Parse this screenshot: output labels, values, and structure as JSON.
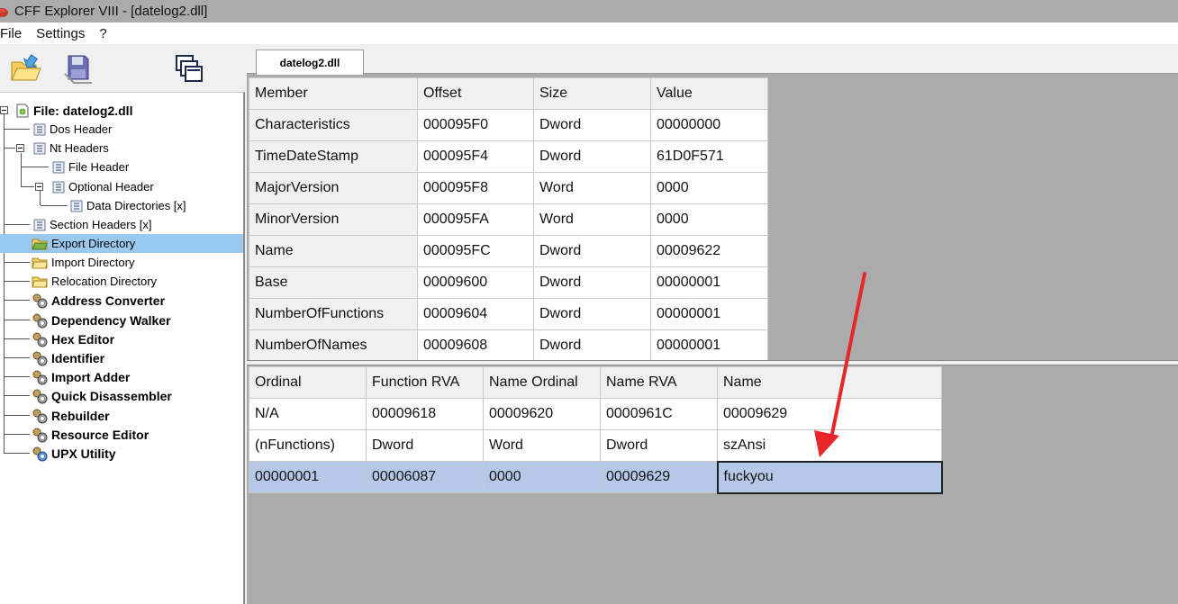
{
  "window": {
    "title": "CFF Explorer VIII - [datelog2.dll]"
  },
  "menu": [
    "File",
    "Settings",
    "?"
  ],
  "tree": {
    "root": "File: datelog2.dll",
    "items": [
      {
        "label": "Dos Header"
      },
      {
        "label": "Nt Headers"
      },
      {
        "label": "File Header"
      },
      {
        "label": "Optional Header"
      },
      {
        "label": "Data Directories [x]"
      },
      {
        "label": "Section Headers [x]"
      },
      {
        "label": "Export Directory"
      },
      {
        "label": "Import Directory"
      },
      {
        "label": "Relocation Directory"
      },
      {
        "label": "Address Converter"
      },
      {
        "label": "Dependency Walker"
      },
      {
        "label": "Hex Editor"
      },
      {
        "label": "Identifier"
      },
      {
        "label": "Import Adder"
      },
      {
        "label": "Quick Disassembler"
      },
      {
        "label": "Rebuilder"
      },
      {
        "label": "Resource Editor"
      },
      {
        "label": "UPX Utility"
      }
    ]
  },
  "tab": {
    "label": "datelog2.dll"
  },
  "export_table": {
    "headers": [
      "Member",
      "Offset",
      "Size",
      "Value"
    ],
    "rows": [
      [
        "Characteristics",
        "000095F0",
        "Dword",
        "00000000"
      ],
      [
        "TimeDateStamp",
        "000095F4",
        "Dword",
        "61D0F571"
      ],
      [
        "MajorVersion",
        "000095F8",
        "Word",
        "0000"
      ],
      [
        "MinorVersion",
        "000095FA",
        "Word",
        "0000"
      ],
      [
        "Name",
        "000095FC",
        "Dword",
        "00009622"
      ],
      [
        "Base",
        "00009600",
        "Dword",
        "00000001"
      ],
      [
        "NumberOfFunctions",
        "00009604",
        "Dword",
        "00000001"
      ],
      [
        "NumberOfNames",
        "00009608",
        "Dword",
        "00000001"
      ]
    ]
  },
  "functions_table": {
    "headers": [
      "Ordinal",
      "Function RVA",
      "Name Ordinal",
      "Name RVA",
      "Name"
    ],
    "rows": [
      [
        "N/A",
        "00009618",
        "00009620",
        "0000961C",
        "00009629"
      ],
      [
        "(nFunctions)",
        "Dword",
        "Word",
        "Dword",
        "szAnsi"
      ],
      [
        "00000001",
        "00006087",
        "0000",
        "00009629",
        "fuckyou"
      ]
    ]
  },
  "colors": {
    "selection": "#99c9ef",
    "row_selection": "#b5c8e8",
    "annotation_arrow": "#e8262a"
  }
}
